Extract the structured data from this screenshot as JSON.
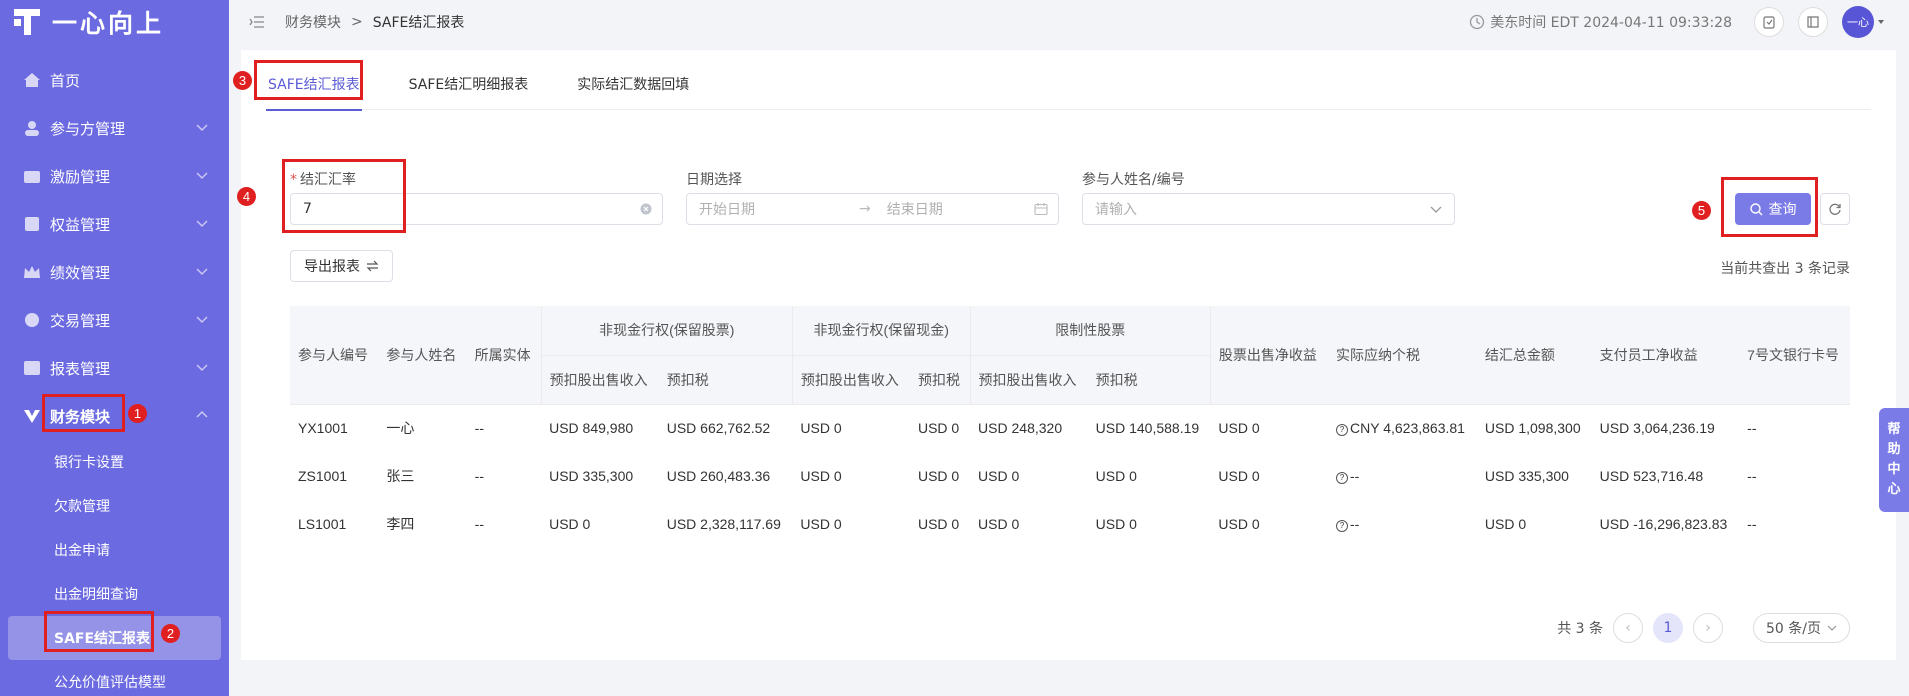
{
  "app": {
    "logo_text": "一心向上"
  },
  "sidebar": {
    "items": [
      {
        "label": "首页",
        "icon": "home-icon"
      },
      {
        "label": "参与方管理",
        "icon": "users-icon"
      },
      {
        "label": "激励管理",
        "icon": "gift-icon"
      },
      {
        "label": "权益管理",
        "icon": "shield-icon"
      },
      {
        "label": "绩效管理",
        "icon": "crown-icon"
      },
      {
        "label": "交易管理",
        "icon": "exchange-icon"
      },
      {
        "label": "报表管理",
        "icon": "report-icon"
      },
      {
        "label": "财务模块",
        "icon": "finance-icon"
      }
    ],
    "sub_items": [
      {
        "label": "银行卡设置"
      },
      {
        "label": "欠款管理"
      },
      {
        "label": "出金申请"
      },
      {
        "label": "出金明细查询"
      },
      {
        "label": "SAFE结汇报表"
      },
      {
        "label": "公允价值评估模型"
      }
    ]
  },
  "breadcrumb": {
    "parent": "财务模块",
    "sep": ">",
    "current": "SAFE结汇报表"
  },
  "header": {
    "time_label": "美东时间 EDT 2024-04-11 09:33:28",
    "avatar_text": "一心"
  },
  "tabs": [
    {
      "label": "SAFE结汇报表"
    },
    {
      "label": "SAFE结汇明细报表"
    },
    {
      "label": "实际结汇数据回填"
    }
  ],
  "filters": {
    "rate_label": "结汇汇率",
    "rate_required": "*",
    "rate_value": "7",
    "date_label": "日期选择",
    "date_start_placeholder": "开始日期",
    "date_end_placeholder": "结束日期",
    "participant_label": "参与人姓名/编号",
    "participant_placeholder": "请输入"
  },
  "buttons": {
    "query": "查询",
    "export": "导出报表"
  },
  "records_text": "当前共查出 3 条记录",
  "table": {
    "headers": {
      "id": "参与人编号",
      "name": "参与人姓名",
      "entity": "所属实体",
      "grp1": "非现金行权(保留股票)",
      "grp2": "非现金行权(保留现金)",
      "grp3": "限制性股票",
      "sub_income": "预扣股出售收入",
      "sub_tax": "预扣税",
      "stock_net": "股票出售净收益",
      "actual_tax": "实际应纳个税",
      "total": "结汇总金额",
      "emp_net": "支付员工净收益",
      "bank": "7号文银行卡号"
    },
    "rows": [
      [
        "YX1001",
        "一心",
        "--",
        "USD 849,980",
        "USD 662,762.52",
        "USD 0",
        "USD 0",
        "USD 248,320",
        "USD 140,588.19",
        "USD 0",
        "CNY 4,623,863.81",
        "USD 1,098,300",
        "USD 3,064,236.19",
        "--"
      ],
      [
        "ZS1001",
        "张三",
        "--",
        "USD 335,300",
        "USD 260,483.36",
        "USD 0",
        "USD 0",
        "USD 0",
        "USD 0",
        "USD 0",
        "--",
        "USD 335,300",
        "USD 523,716.48",
        "--"
      ],
      [
        "LS1001",
        "李四",
        "--",
        "USD 0",
        "USD 2,328,117.69",
        "USD 0",
        "USD 0",
        "USD 0",
        "USD 0",
        "USD 0",
        "--",
        "USD 0",
        "USD -16,296,823.83",
        "--"
      ]
    ]
  },
  "pagination": {
    "total_text": "共 3 条",
    "current_page": "1",
    "page_size": "50 条/页"
  },
  "help": {
    "chars": [
      "帮",
      "助",
      "中",
      "心"
    ]
  },
  "annotations": [
    "1",
    "2",
    "3",
    "4",
    "5"
  ],
  "colors": {
    "sidebar": "#6b6ae0",
    "accent": "#5b5bd6",
    "highlight": "#e02020"
  }
}
